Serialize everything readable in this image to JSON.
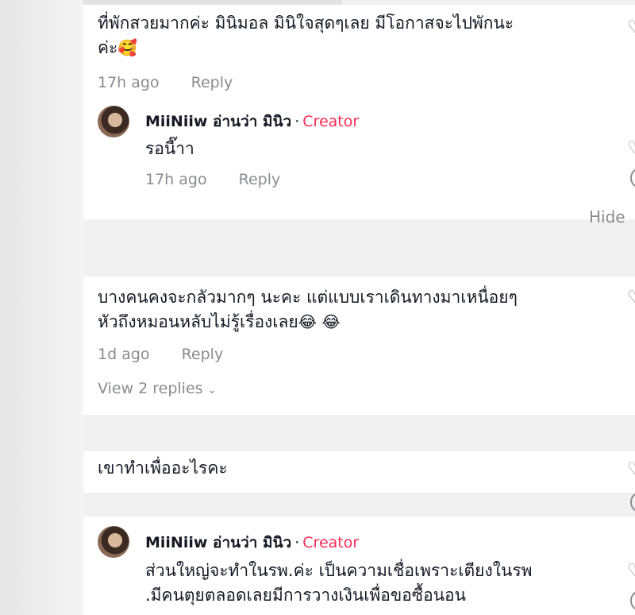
{
  "comments": [
    {
      "text": "ที่พักสวยมากค่ะ มินิมอล มินิใจสุดๆเลย มีโอกาสจะไปพักนะค่ะ",
      "text_line1": "ที่พักสวยมากค่ะ มินิมอล มินิใจสุดๆเลย มีโอกาสจะไปพักนะ",
      "text_line2": "ค่ะ",
      "emoji": "🥰",
      "time": "17h ago",
      "reply_label": "Reply"
    },
    {
      "author": "MiiNiiw อ่านว่า มินิว",
      "separator": "·",
      "badge": "Creator",
      "text": "รอนี๊าา",
      "time": "17h ago",
      "reply_label": "Reply",
      "is_reply": true
    },
    {
      "text_line1": "บางคนคงจะกลัวมากๆ นะคะ แต่แบบเราเดินทางมาเหนื่อยๆ",
      "text_line2": "หัวถึงหมอนหลับไม่รู้เรื่องเลย",
      "emoji": "😂 😂",
      "time": "1d ago",
      "reply_label": "Reply",
      "view_replies": "View 2 replies"
    },
    {
      "text": "เขาทำเพื่ออะไรคะ"
    },
    {
      "author": "MiiNiiw อ่านว่า มินิว",
      "separator": "·",
      "badge": "Creator",
      "text_line1": "ส่วนใหญ่จะทำในรพ.ค่ะ เป็นความเชื่อเพราะเตียงในรพ",
      "text_line2": ".มีคนตุยตลอดเลยมีการวางเงินเพื่อขอซื้อนอน",
      "is_reply": true
    }
  ],
  "hide_label": "Hide",
  "colors": {
    "creator": "#fe2c55",
    "muted": "#8a8b91",
    "text": "#161823"
  },
  "icons": [
    "heart-icon",
    "chevron-down-icon",
    "avatar"
  ]
}
